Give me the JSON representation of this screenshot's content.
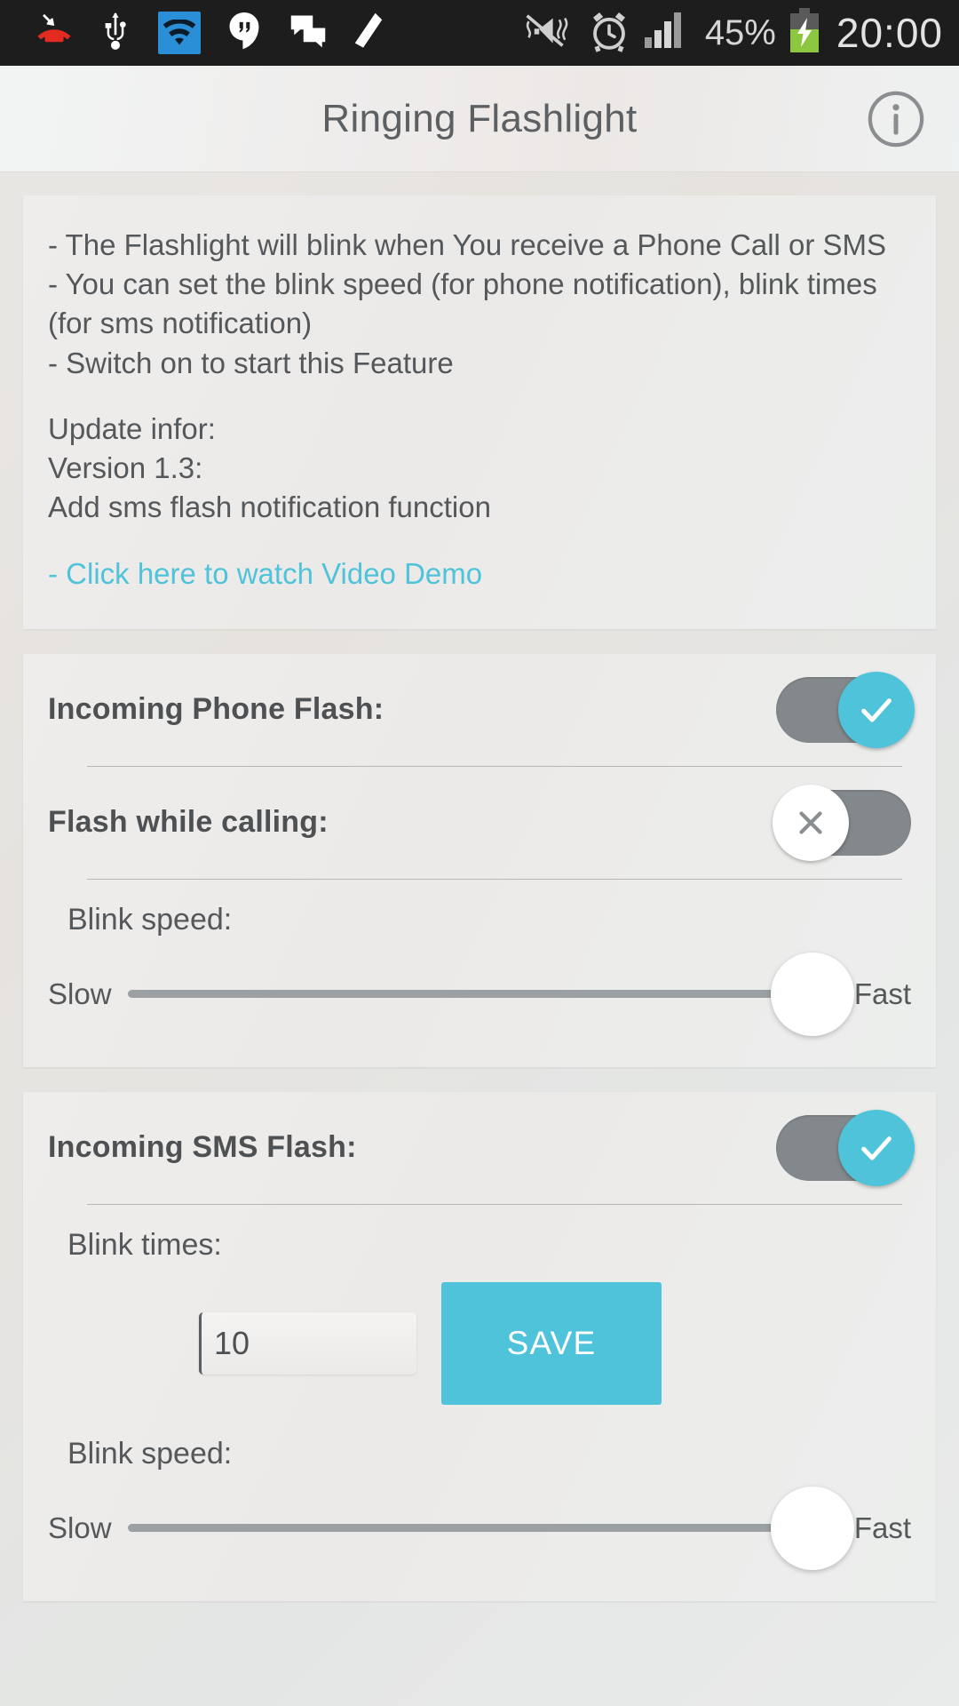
{
  "statusbar": {
    "icons_left": [
      "missed-call-icon",
      "usb-icon",
      "wifi-icon",
      "hangouts-icon",
      "messages-icon",
      "edit-icon"
    ],
    "icons_right": [
      "vibrate-off-icon",
      "alarm-icon",
      "signal-icon"
    ],
    "battery_percent": "45%",
    "battery_state": "charging",
    "clock": "20:00"
  },
  "appbar": {
    "title": "Ringing Flashlight",
    "info_icon": "info-icon"
  },
  "info_card": {
    "body": "- The Flashlight will blink when You receive a Phone Call or SMS\n- You can set the blink speed (for phone notification), blink times (for sms notification)\n- Switch on to start this Feature",
    "update_block": "Update infor:\nVersion 1.3:\n Add sms flash notification function",
    "link": "- Click here to watch Video Demo"
  },
  "phone_card": {
    "incoming_label": "Incoming Phone Flash:",
    "incoming_state": "on",
    "incoming_glyph": "check-icon",
    "calling_label": "Flash while calling:",
    "calling_state": "off",
    "calling_glyph": "close-icon",
    "blink_speed_label": "Blink speed:",
    "slow_label": "Slow",
    "fast_label": "Fast",
    "slider_value": 100
  },
  "sms_card": {
    "incoming_label": "Incoming SMS Flash:",
    "incoming_state": "on",
    "incoming_glyph": "check-icon",
    "blink_times_label": "Blink times:",
    "blink_times_value": "10",
    "blink_times_placeholder": "10",
    "save_label": "SAVE",
    "blink_speed_label": "Blink speed:",
    "slow_label": "Slow",
    "fast_label": "Fast",
    "slider_value": 100
  },
  "colors": {
    "accent": "#4ec3da",
    "track": "#83888c",
    "text": "#55585b",
    "statusbar_bg": "#1d1d1d",
    "battery_green": "#8dc63f"
  }
}
